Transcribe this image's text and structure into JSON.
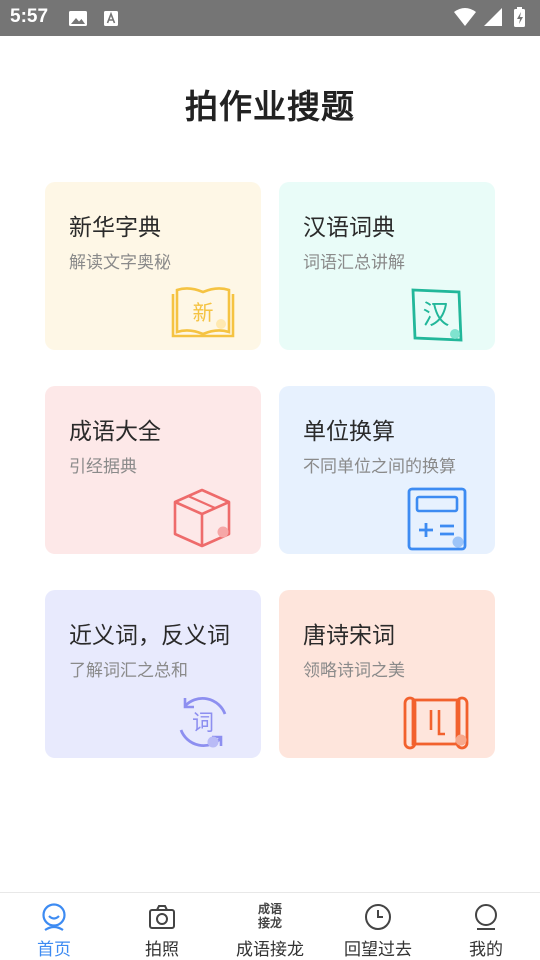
{
  "status_bar": {
    "time": "5:57"
  },
  "title": "拍作业搜题",
  "cards": [
    {
      "title": "新华字典",
      "subtitle": "解读文字奥秘",
      "icon": "book-icon",
      "icon_char": "新",
      "bg": "#fef7e6",
      "accent": "#f5c342"
    },
    {
      "title": "汉语词典",
      "subtitle": "词语汇总讲解",
      "icon": "han-icon",
      "icon_char": "汉",
      "bg": "#e9fcf8",
      "accent": "#22b79a"
    },
    {
      "title": "成语大全",
      "subtitle": "引经据典",
      "icon": "cube-icon",
      "bg": "#fde8e8",
      "accent": "#ee6b6b"
    },
    {
      "title": "单位换算",
      "subtitle": "不同单位之间的换算",
      "icon": "calculator-icon",
      "bg": "#e7f1fe",
      "accent": "#3d8bf2"
    },
    {
      "title": "近义词，反义词",
      "subtitle": "了解词汇之总和",
      "icon": "cycle-ci-icon",
      "icon_char": "词",
      "bg": "#e8eafd",
      "accent": "#8d8ff0"
    },
    {
      "title": "唐诗宋词",
      "subtitle": "领略诗词之美",
      "icon": "scroll-icon",
      "bg": "#fee5dc",
      "accent": "#f2612d"
    }
  ],
  "nav": {
    "items": [
      {
        "label": "首页",
        "icon": "home-face-icon",
        "active": true
      },
      {
        "label": "拍照",
        "icon": "camera-icon",
        "active": false
      },
      {
        "label": "成语接龙",
        "icon": "idiom-icon",
        "icon_text": [
          "成语",
          "接龙"
        ],
        "active": false
      },
      {
        "label": "回望过去",
        "icon": "clock-icon",
        "active": false
      },
      {
        "label": "我的",
        "icon": "profile-icon",
        "active": false
      }
    ],
    "active_color": "#3d8bf2"
  }
}
